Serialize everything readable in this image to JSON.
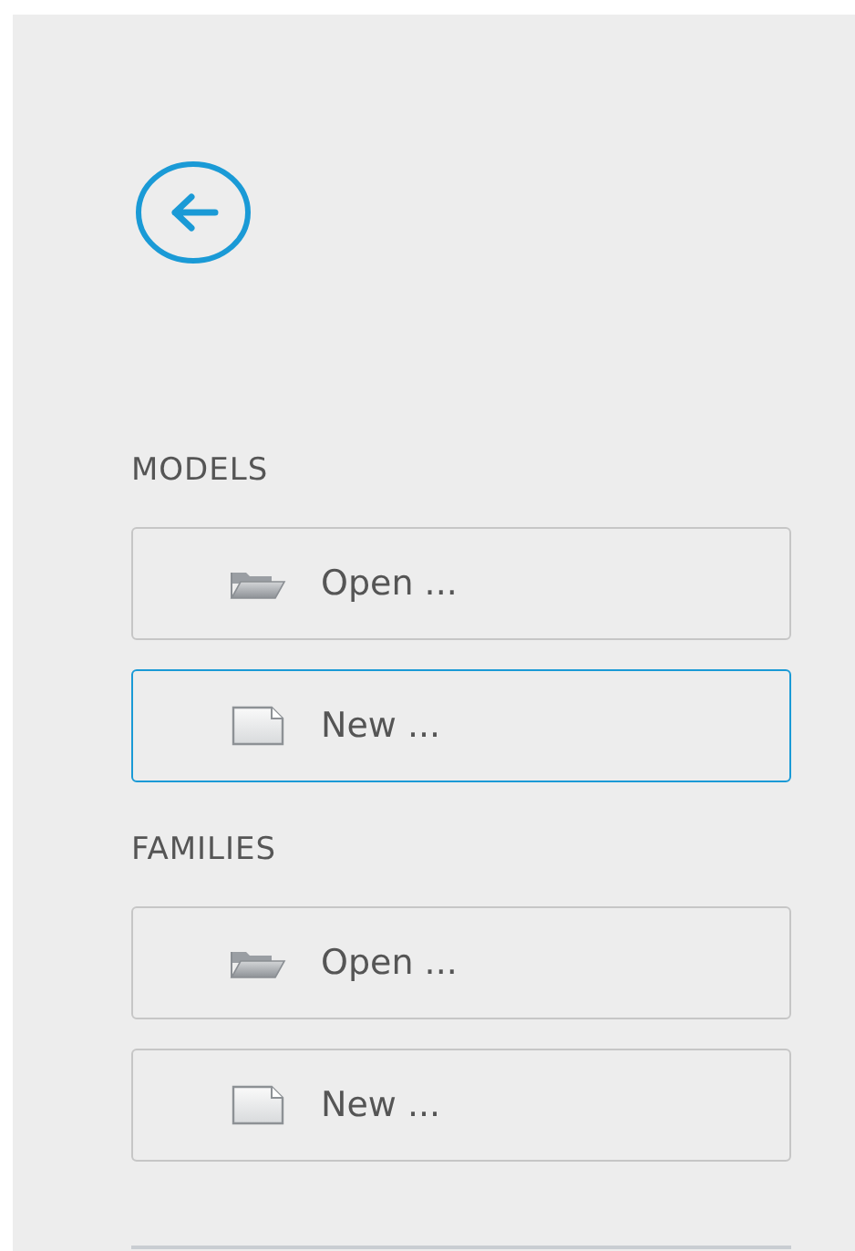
{
  "back_button": {
    "kind": "back"
  },
  "sections": [
    {
      "title": "MODELS",
      "items": [
        {
          "kind": "open",
          "label": "Open ...",
          "focused": false
        },
        {
          "kind": "new",
          "label": "New ...",
          "focused": true
        }
      ]
    },
    {
      "title": "FAMILIES",
      "items": [
        {
          "kind": "open",
          "label": "Open ...",
          "focused": false
        },
        {
          "kind": "new",
          "label": "New ...",
          "focused": false
        }
      ]
    }
  ]
}
